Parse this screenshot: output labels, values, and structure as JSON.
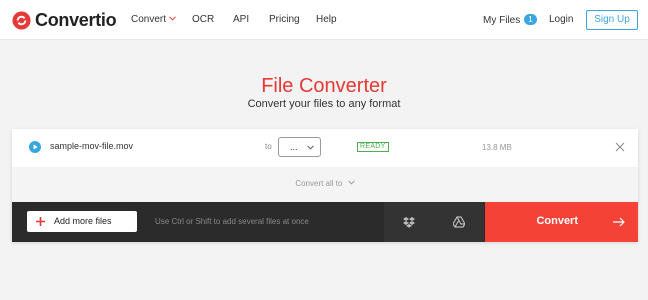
{
  "header": {
    "logo_text": "Convertio",
    "nav": [
      {
        "label": "Convert"
      },
      {
        "label": "OCR"
      },
      {
        "label": "API"
      },
      {
        "label": "Pricing"
      },
      {
        "label": "Help"
      }
    ],
    "my_files_label": "My Files",
    "my_files_count": "1",
    "login_label": "Login",
    "signup_label": "Sign Up"
  },
  "hero": {
    "title": "File Converter",
    "subtitle": "Convert your files to any format"
  },
  "file": {
    "name": "sample-mov-file.mov",
    "to_label": "to",
    "format_value": "...",
    "status": "READY",
    "size": "13.8 MB"
  },
  "convert_all_label": "Convert all to",
  "action_bar": {
    "add_more_label": "Add more files",
    "hint": "Use Ctrl or Shift to add several files at once",
    "convert_label": "Convert"
  },
  "colors": {
    "brand_red": "#e53935",
    "convert_red": "#f44336",
    "accent_blue": "#3aa6e0",
    "status_green": "#4caf50",
    "bar_dark": "#2b2b2b"
  },
  "icons": [
    "convertio-logo-icon",
    "chevron-down-icon",
    "play-icon",
    "close-icon",
    "plus-icon",
    "dropbox-icon",
    "google-drive-icon",
    "arrow-right-icon"
  ]
}
